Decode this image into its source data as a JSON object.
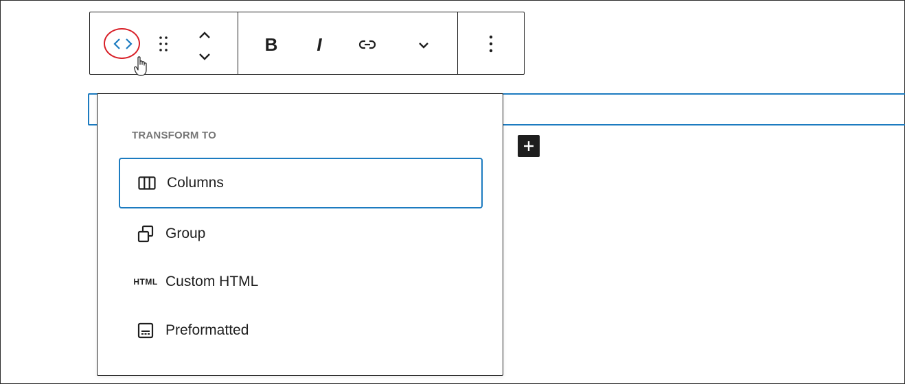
{
  "toolbar": {
    "transform_button": "code-brackets-icon",
    "drag_handle": "drag-handle-icon",
    "move_up": "chevron-up-icon",
    "move_down": "chevron-down-icon",
    "bold_label": "B",
    "italic_label": "I",
    "link": "link-icon",
    "more_formatting": "chevron-down-icon",
    "options": "more-vertical-icon"
  },
  "popover": {
    "title": "TRANSFORM TO",
    "items": [
      {
        "label": "Columns",
        "icon": "columns-icon",
        "selected": true
      },
      {
        "label": "Group",
        "icon": "group-icon",
        "selected": false
      },
      {
        "label": "Custom HTML",
        "icon": "html-icon",
        "badge": "HTML",
        "selected": false
      },
      {
        "label": "Preformatted",
        "icon": "preformatted-icon",
        "selected": false
      }
    ]
  },
  "colors": {
    "accent": "#1c7bc0",
    "highlight_ring": "#d81e26",
    "text": "#1e1e1e",
    "muted": "#757575"
  }
}
